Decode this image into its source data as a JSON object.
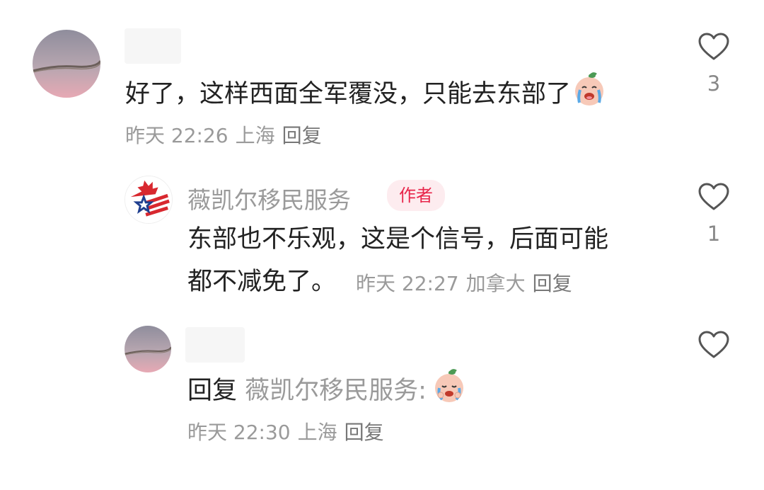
{
  "comments": [
    {
      "text": "好了，这样西面全军覆没，只能去东部了",
      "emoji": "crying-face-emoji",
      "time": "昨天 22:26",
      "location": "上海",
      "reply_label": "回复",
      "like_count": "3"
    },
    {
      "author": "薇凯尔移民服务",
      "author_badge": "作者",
      "text_line1": "东部也不乐观，这是个信号，后面可能",
      "text_line2": "都不减免了。",
      "time": "昨天 22:27",
      "location": "加拿大",
      "reply_label": "回复",
      "like_count": "1"
    },
    {
      "reply_prefix": "回复",
      "mention": "薇凯尔移民服务:",
      "emoji": "crying-face-emoji",
      "time": "昨天 22:30",
      "location": "上海",
      "reply_label": "回复",
      "like_count": ""
    }
  ],
  "icons": {
    "like": "heart-outline-icon",
    "avatar_user": "sunset-branch-avatar",
    "avatar_author": "maple-leaf-star-logo"
  },
  "colors": {
    "text": "#222222",
    "muted": "#9a9a9a",
    "badge_text": "#e8254a",
    "badge_bg": "#fdecef"
  }
}
